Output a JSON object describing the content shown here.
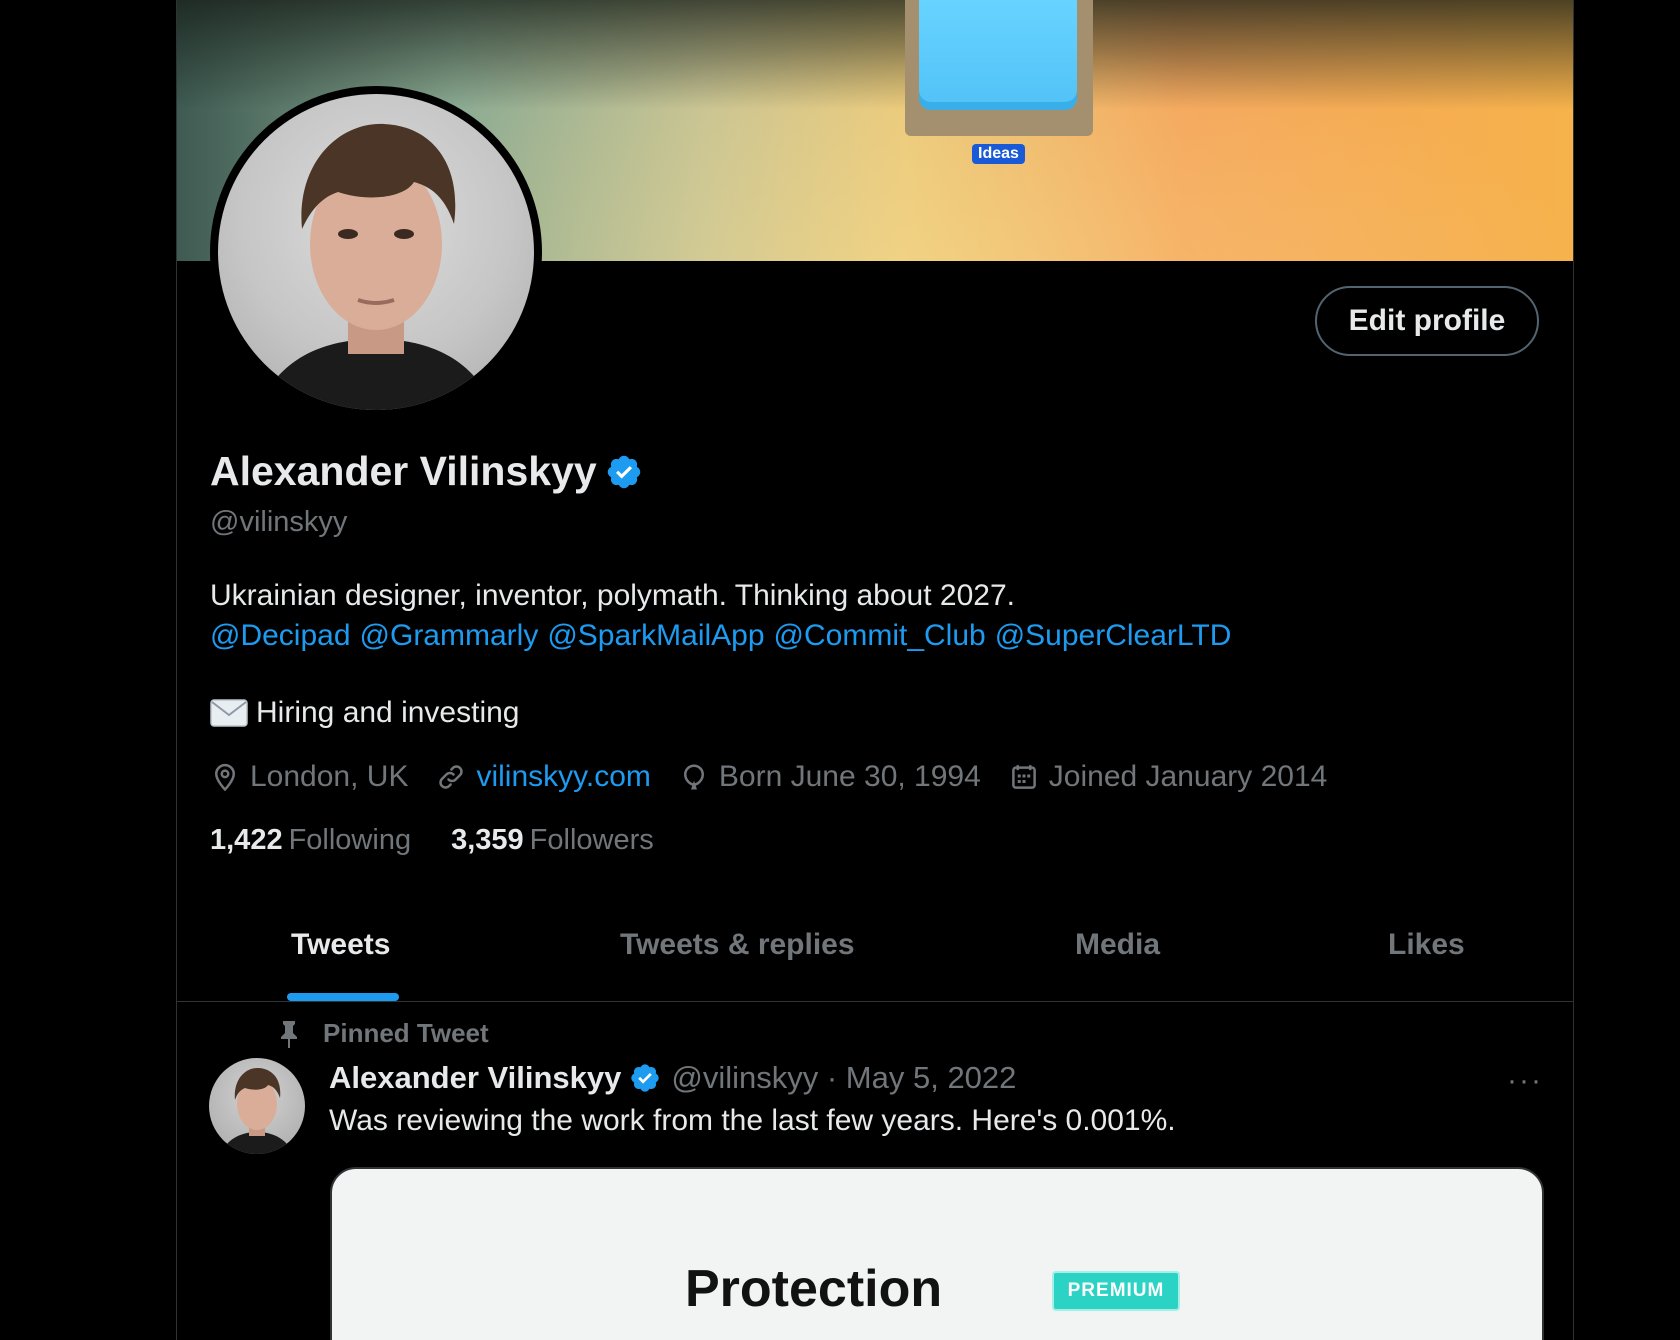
{
  "banner": {
    "folder_label": "Ideas"
  },
  "profile": {
    "name": "Alexander Vilinskyy",
    "handle": "@vilinskyy",
    "edit_button": "Edit profile",
    "bio_line": "Ukrainian designer, inventor, polymath. Thinking about 2027.",
    "mentions": [
      "@Decipad",
      "@Grammarly",
      "@SparkMailApp",
      "@Commit_Club",
      "@SuperClearLTD"
    ],
    "hiring": "Hiring and investing",
    "location": "London, UK",
    "website": "vilinskyy.com",
    "born": "Born June 30, 1994",
    "joined": "Joined January 2014",
    "following_count": "1,422",
    "following_label": "Following",
    "followers_count": "3,359",
    "followers_label": "Followers"
  },
  "tabs": [
    {
      "label": "Tweets",
      "active": true
    },
    {
      "label": "Tweets & replies",
      "active": false
    },
    {
      "label": "Media",
      "active": false
    },
    {
      "label": "Likes",
      "active": false
    }
  ],
  "tweet": {
    "pinned_label": "Pinned Tweet",
    "author_name": "Alexander Vilinskyy",
    "meta": "@vilinskyy · May 5, 2022",
    "more": "···",
    "text": "Was reviewing the work from the last few years. Here's 0.001%.",
    "media_title": "Protection",
    "media_badge": "PREMIUM"
  },
  "colors": {
    "background": "#000000",
    "accent": "#1d9bf0",
    "primary_text": "#e7e9ea",
    "secondary_text": "#71767b",
    "border": "#2f3336"
  },
  "icons": [
    "verified-badge-icon",
    "envelope-icon",
    "location-pin-icon",
    "link-icon",
    "balloon-icon",
    "calendar-icon",
    "pin-icon",
    "more-icon"
  ]
}
